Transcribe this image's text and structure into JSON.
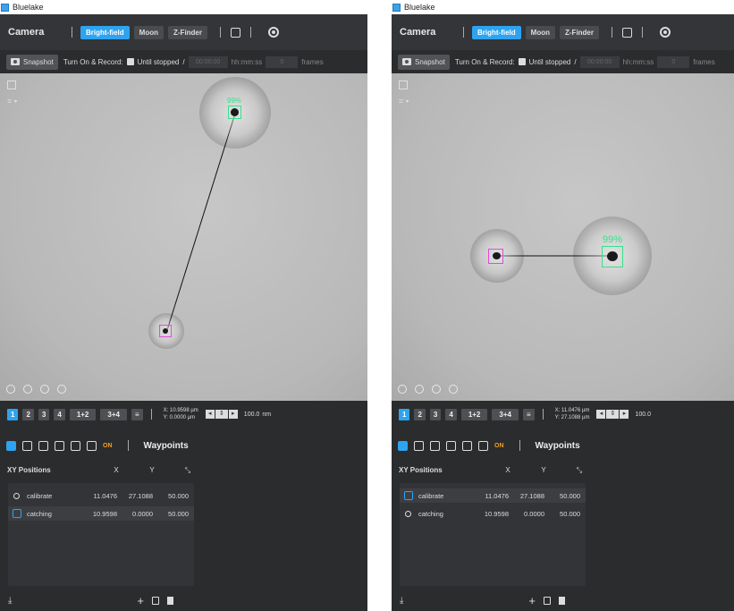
{
  "app_title": "Bluelake",
  "camera": {
    "title": "Camera",
    "modes": [
      "Bright-field",
      "Moon",
      "Z-Finder"
    ]
  },
  "snapshot": {
    "button_label": "Snapshot",
    "record_label": "Turn On & Record:",
    "until_label": "Until stopped",
    "slash": "/",
    "time_value": "00:00:00",
    "time_unit": "hh:mm:ss",
    "frames_value": "0",
    "frames_unit": "frames"
  },
  "panels": [
    {
      "beads": [
        {
          "role": "calibrate",
          "label": "99%",
          "color": "#39e08a"
        },
        {
          "role": "catching",
          "label": "",
          "color": "#e14cd8"
        }
      ],
      "position": {
        "x": "X: 10.9598 µm",
        "y": "Y: 0.0000 µm"
      },
      "step": "100.0",
      "step_unit": "nm",
      "selected_row": 1
    },
    {
      "beads": [
        {
          "role": "calibrate",
          "label": "99%",
          "color": "#39e08a"
        },
        {
          "role": "catching",
          "label": "",
          "color": "#e14cd8"
        }
      ],
      "position": {
        "x": "X: 11.0476 µm",
        "y": "Y: 27.1088 µm"
      },
      "step": "100.0",
      "step_unit": "",
      "selected_row": 0
    }
  ],
  "toolbar": {
    "buttons": [
      "1",
      "2",
      "3",
      "4",
      "1+2",
      "3+4"
    ]
  },
  "waypoints": {
    "title": "Waypoints",
    "on_label": "ON",
    "xy_label": "XY Positions",
    "col_x": "X",
    "col_y": "Y",
    "rows": [
      {
        "name": "calibrate",
        "x": "11.0476",
        "y": "27.1088",
        "z": "50.000"
      },
      {
        "name": "catching",
        "x": "10.9598",
        "y": "0.0000",
        "z": "50.000"
      }
    ]
  }
}
